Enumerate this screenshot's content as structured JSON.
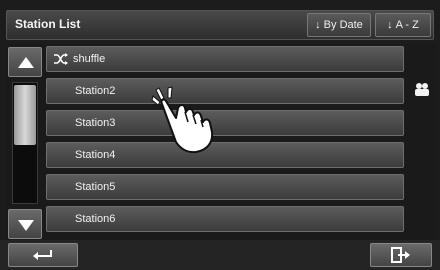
{
  "header": {
    "title": "Station List",
    "sort_by_date_label": "By Date",
    "sort_az_label": "A - Z"
  },
  "list": {
    "items": [
      {
        "label": "shuffle",
        "icon": "shuffle-icon"
      },
      {
        "label": "Station2"
      },
      {
        "label": "Station3"
      },
      {
        "label": "Station4"
      },
      {
        "label": "Station5"
      },
      {
        "label": "Station6"
      }
    ]
  },
  "icons": {
    "scroll_up": "scroll-up-icon",
    "scroll_down": "scroll-down-icon",
    "side": "people-icon",
    "back": "back-arrow-icon",
    "exit": "exit-icon",
    "hand": "touch-hand-icon"
  }
}
